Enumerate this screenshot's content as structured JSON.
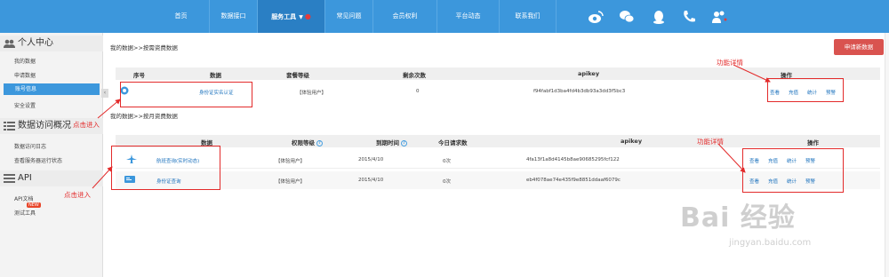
{
  "nav": {
    "items": [
      {
        "label": "首页"
      },
      {
        "label": "数据接口"
      },
      {
        "label": "服务工具"
      },
      {
        "label": "常见问题"
      },
      {
        "label": "会员权利"
      },
      {
        "label": "平台动态"
      },
      {
        "label": "联系我们"
      }
    ],
    "icons": [
      "weibo-icon",
      "wechat-icon",
      "qq-icon",
      "phone-icon",
      "users-icon"
    ],
    "brand_color": "#3c97dc"
  },
  "sidebar": {
    "personal": {
      "title": "个人中心",
      "items": [
        "我的数据",
        "申请数据",
        "账号信息",
        "安全设置"
      ]
    },
    "stats": {
      "title": "数据访问概况",
      "items": [
        "数据访问日志",
        "查看服务器运行状态"
      ]
    },
    "api": {
      "title": "API",
      "items": [
        "API文档",
        "测试工具"
      ],
      "badge": "NEW"
    }
  },
  "main": {
    "apply_button": "申请新数据",
    "section1": {
      "breadcrumb": "我的数据>>按需资费数据",
      "headers": [
        "序号",
        "数据",
        "套餐等级",
        "剩余次数",
        "apikey",
        "操作"
      ],
      "rows": [
        {
          "data": "身份证实名认证",
          "level": "【体验用户】",
          "remaining": "0",
          "apikey": "f94fabf1d3ba4fd4b3db93a3dd3f5bc3",
          "ops": [
            "查看",
            "充值",
            "统计",
            "预警"
          ]
        }
      ]
    },
    "section2": {
      "breadcrumb": "我的数据>>按月资费数据",
      "headers": [
        "数据",
        "权限等级",
        "到期时间",
        "今日请求数",
        "apikey",
        "操作"
      ],
      "rows": [
        {
          "data": "航班查询(实时动态)",
          "level": "【体验用户】",
          "expires": "2015/4/10",
          "today": "0次",
          "apikey": "4fa13f1a8d4145b8ae90685295fcf122",
          "ops": [
            "查看",
            "充值",
            "统计",
            "预警"
          ]
        },
        {
          "data": "身份证查询",
          "level": "【体验用户】",
          "expires": "2015/4/10",
          "today": "0次",
          "apikey": "eb4f078ae74e435f9e8851ddaaf6079c",
          "ops": [
            "查看",
            "充值",
            "统计",
            "预警"
          ]
        }
      ]
    }
  },
  "annotations": {
    "feature_detail_1": "功能详情",
    "feature_detail_2": "功能详情",
    "click_enter_1": "点击进入",
    "click_enter_2": "点击进入",
    "color": "#e32b2b"
  },
  "watermark": {
    "main": "Bai 经验",
    "sub": "jingyan.baidu.com"
  }
}
